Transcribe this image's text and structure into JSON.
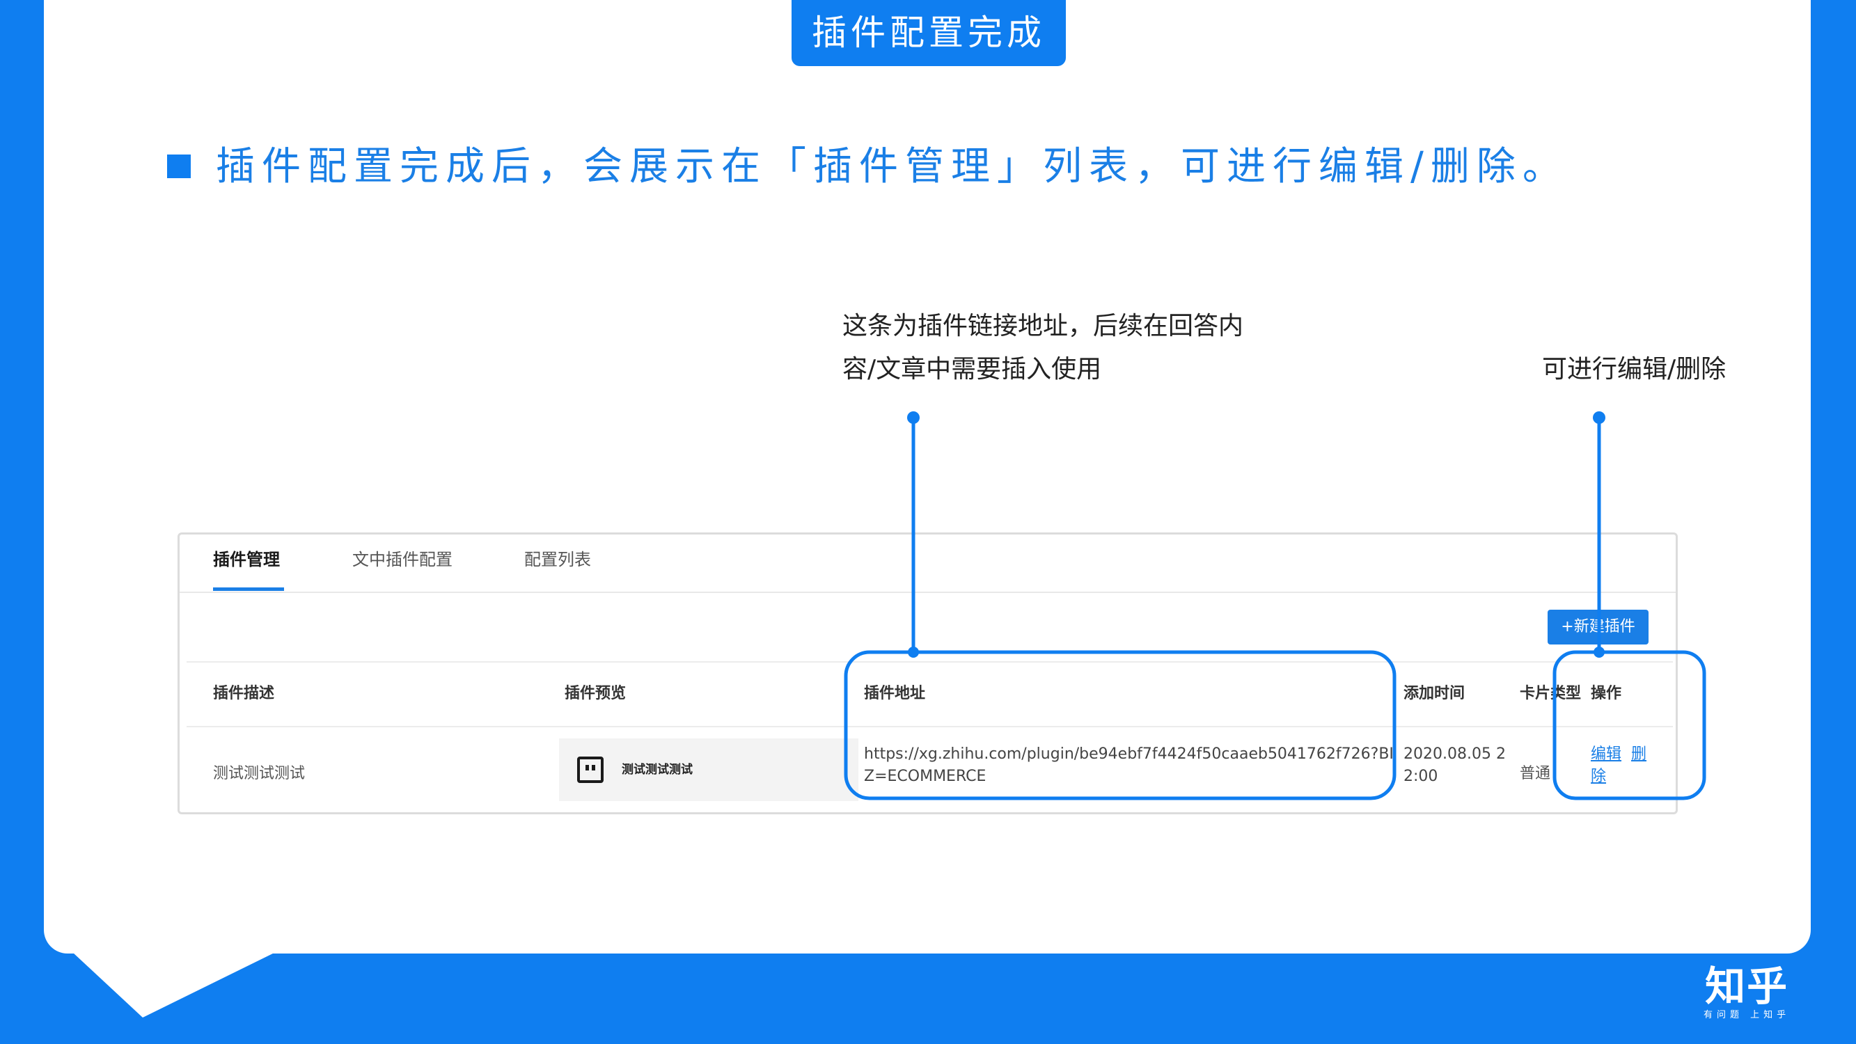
{
  "slide": {
    "title": "插件配置完成",
    "headline": "插件配置完成后，会展示在「插件管理」列表，可进行编辑/删除。",
    "annotation_left_line1": "这条为插件链接地址，后续在回答内",
    "annotation_left_line2": "容/文章中需要插入使用",
    "annotation_right": "可进行编辑/删除",
    "logo_main": "知乎",
    "logo_sub": "有问题 上知乎",
    "accent_color": "#0f7ef0"
  },
  "panel": {
    "tabs": [
      {
        "label": "插件管理",
        "active": true
      },
      {
        "label": "文中插件配置",
        "active": false
      },
      {
        "label": "配置列表",
        "active": false
      }
    ],
    "new_button_label": "+新建插件",
    "columns": [
      "插件描述",
      "插件预览",
      "插件地址",
      "添加时间",
      "卡片类型",
      "操作"
    ],
    "rows": [
      {
        "description": "测试测试测试",
        "preview_text": "测试测试测试",
        "url": "https://xg.zhihu.com/plugin/be94ebf7f4424f50caaeb5041762f726?BIZ=ECOMMERCE",
        "added_time": "2020.08.05 22:00",
        "card_type": "普通",
        "actions": [
          "编辑",
          "删除"
        ]
      }
    ]
  }
}
